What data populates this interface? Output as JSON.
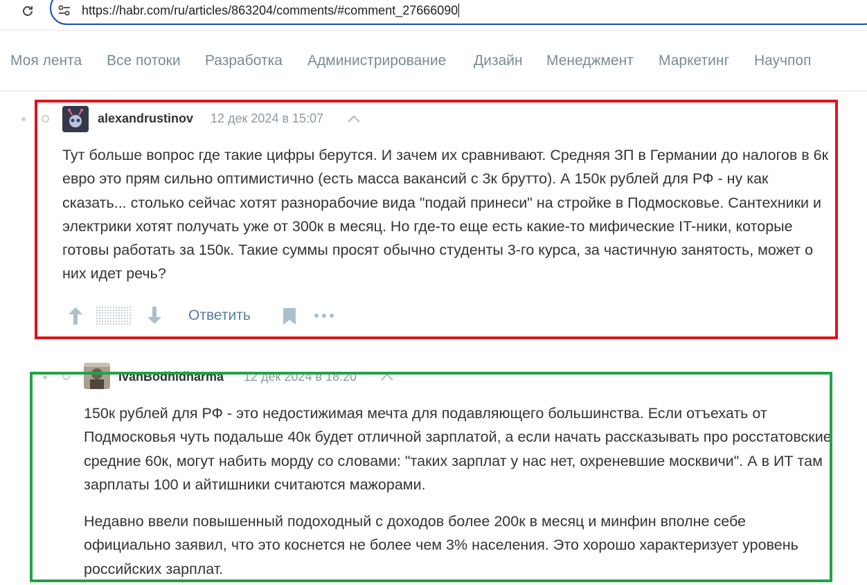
{
  "browser": {
    "url": "https://habr.com/ru/articles/863204/comments/#comment_27666090"
  },
  "nav": {
    "items": [
      "Моя лента",
      "Все потоки",
      "Разработка",
      "Администрирование",
      "Дизайн",
      "Менеджмент",
      "Маркетинг",
      "Научпоп"
    ]
  },
  "comments": [
    {
      "username": "alexandrustinov",
      "time": "12 дек 2024 в 15:07",
      "paragraphs": [
        "Тут больше вопрос где такие цифры берутся. И зачем их сравнивают. Средняя ЗП в Германии до налогов в 6к евро это прям сильно оптимистично (есть масса вакансий с 3к брутто). А 150к рублей для РФ - ну как сказать... столько сейчас хотят разнорабочие вида \"подай принеси\" на стройке в Подмосковье. Сантехники и электрики хотят получать уже от 300к в месяц. Но где-то еще есть какие-то мифические IT-ники, которые готовы работать за 150к. Такие суммы просят обычно студенты 3-го курса, за частичную занятость, может о них идет речь?"
      ],
      "reply_label": "Ответить"
    },
    {
      "username": "IvanBodhidharma",
      "time": "12 дек 2024 в 18:20",
      "paragraphs": [
        "150к рублей для РФ - это недостижимая мечта для подавляющего большинства. Если отъехать от Подмосковья чуть подальше 40к будет отличной зарплатой, а если начать рассказывать про росстатовские средние 60к, могут набить морду со словами: \"таких зарплат у нас нет, охреневшие москвичи\". А в ИТ там зарплаты 100 и айтишники считаются мажорами.",
        "Недавно ввели повышенный подоходный с доходов более 200к в месяц и минфин вполне себе официально заявил, что это коснется не более чем 3% населения. Это хорошо характеризует уровень российских зарплат."
      ]
    }
  ],
  "colors": {
    "highlight_red": "#e0131b",
    "highlight_green": "#21a345",
    "url_focus_ring": "#1a4fa6",
    "reply_link": "#5a7d96"
  }
}
